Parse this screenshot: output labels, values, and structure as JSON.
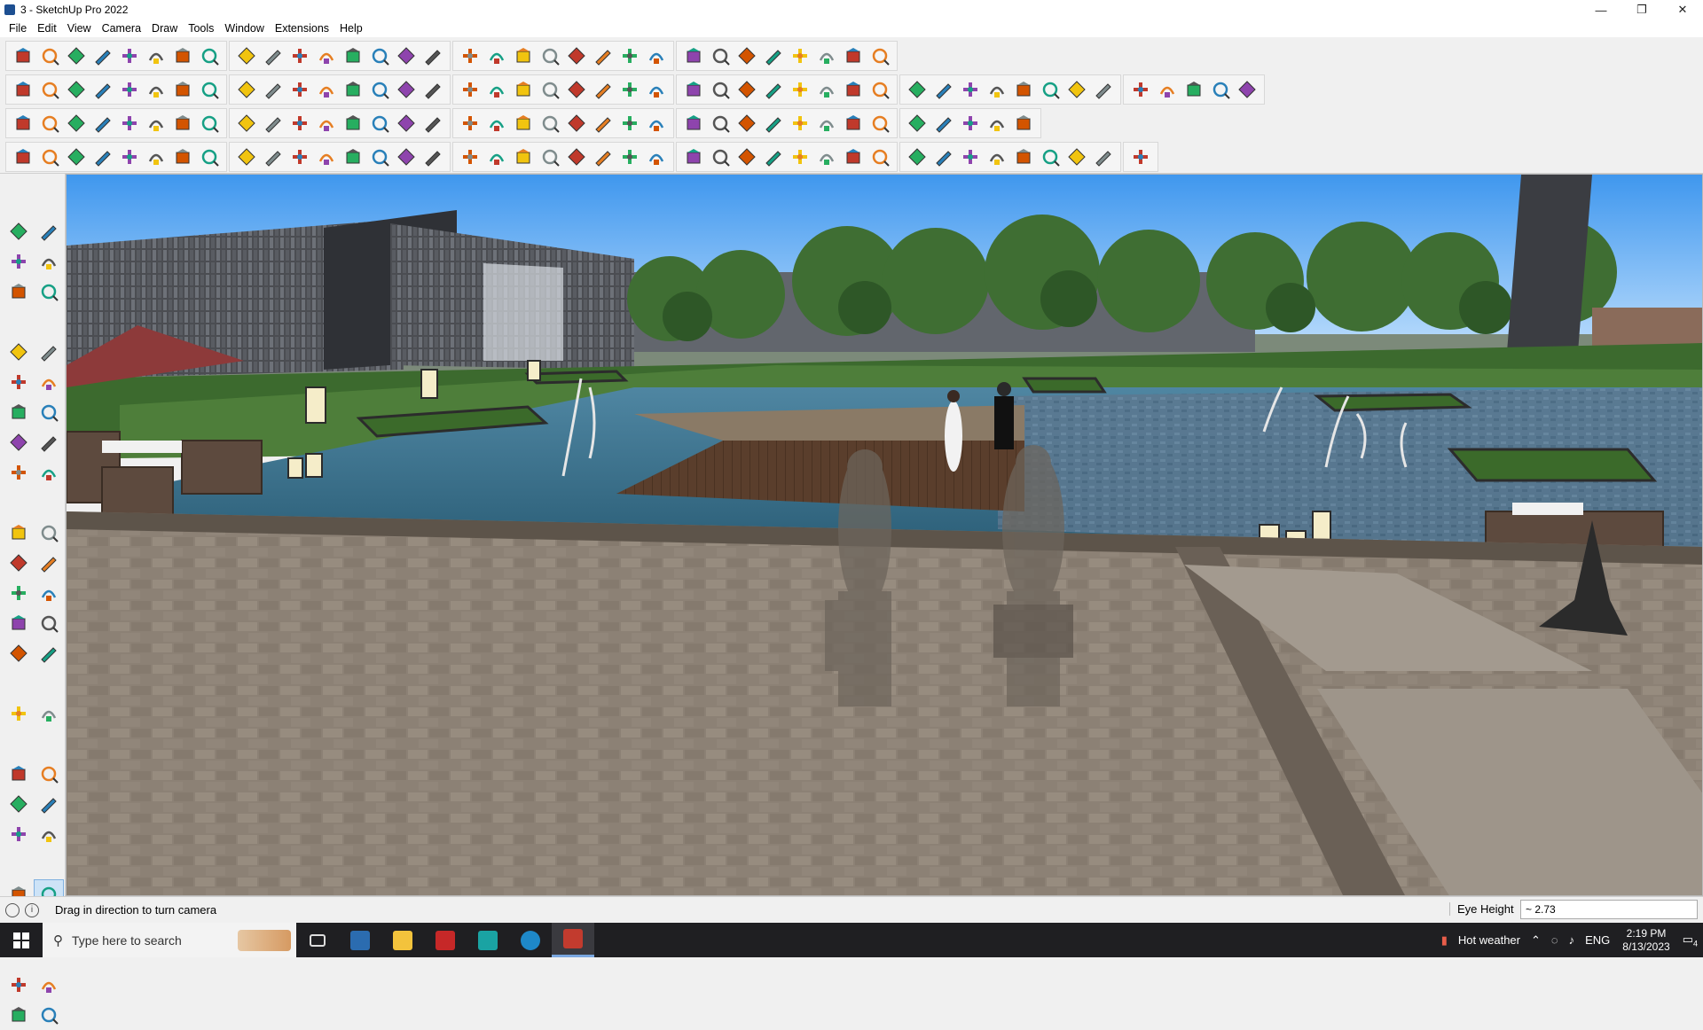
{
  "window": {
    "title": "3 - SketchUp Pro 2022",
    "minimize": "—",
    "maximize": "❐",
    "close": "✕"
  },
  "menu": [
    "File",
    "Edit",
    "View",
    "Camera",
    "Draw",
    "Tools",
    "Window",
    "Extensions",
    "Help"
  ],
  "status": {
    "hint": "Drag in direction to turn camera",
    "vcb_label": "Eye Height",
    "vcb_value": "~ 2.73"
  },
  "taskbar": {
    "search_placeholder": "Type here to search",
    "weather": "Hot weather",
    "language": "ENG",
    "time": "2:19 PM",
    "date": "8/13/2023",
    "notifications": "4"
  },
  "colors": {
    "accent": "#1d6fc4",
    "taskbar": "#1f1f22"
  },
  "icons": {
    "toolbar_row1": [
      "zoom-icon",
      "select-icon",
      "eraser-icon",
      "pencil-icon",
      "lasso-icon",
      "rectangle-icon",
      "push-pull-icon",
      "follow-me-icon",
      "move-icon",
      "rotate-icon",
      "scale-icon",
      "tape-measure-icon",
      "text-icon",
      "paint-bucket-icon",
      "orbit-icon",
      "pan-icon",
      "zoom-window-icon",
      "zoom-extents-icon",
      "components-icon",
      "styles-icon",
      "layers-icon",
      "scenes-icon",
      "user-icon",
      "model-info-icon",
      "sandbox-icon",
      "section-plane-icon",
      "arrows-icon",
      "export-icon",
      "axes-icon",
      "undo-icon",
      "redo-icon",
      "help-icon"
    ],
    "toolbar_row2": [
      "iso-view-icon",
      "top-view-icon",
      "front-view-icon",
      "extension-icon",
      "solid-union-icon",
      "solid-subtract-icon",
      "solid-intersect-icon",
      "solid-trim-icon",
      "solid-split-icon",
      "solid-outer-icon",
      "solid-shell-icon",
      "solid-fix-icon",
      "curve-icon",
      "line-tool-icon",
      "edge-tool-icon",
      "dimension-icon",
      "layer-flat-icon",
      "layer-up-icon",
      "roof-icon",
      "wall-icon",
      "house-icon",
      "house-outline-icon",
      "roof-open-icon",
      "fence-icon",
      "leaf-icon",
      "brush-icon",
      "circle-a-icon",
      "circle-b-icon",
      "polygon-a-icon",
      "polygon-b-icon",
      "ellipse-icon",
      "shape-a-icon",
      "shape-b-icon",
      "shape-c-icon",
      "shape-d-icon",
      "shape-e-icon",
      "arrow-red-icon",
      "eraser-pink-icon",
      "panel-a-icon",
      "panel-b-icon",
      "tile-a-icon",
      "tile-b-icon",
      "tile-c-icon",
      "tile-d-icon",
      "tile-e-icon"
    ],
    "toolbar_row3": [
      "cube-blue-icon",
      "diamond-blue-icon",
      "diamond-yellow-icon",
      "diamond-green-icon",
      "diamond-red-icon",
      "diamond-white-icon",
      "arc-orange-icon",
      "square-red-icon",
      "grid-box-icon",
      "panel-flip-icon",
      "block-icon",
      "chain-icon",
      "bracket-icon",
      "dots-line-icon",
      "cross-red-icon",
      "cross-green-icon",
      "cross-blue-icon",
      "cone-teal-icon",
      "pyramid-teal-icon",
      "triangle-warning-icon",
      "hook-icon",
      "nut-icon",
      "spiral-icon",
      "star-move-icon",
      "bucket-icon",
      "curl-red-icon",
      "frame-green-icon",
      "gear-icon",
      "cubes-icon",
      "box-red-icon",
      "ring-icon",
      "wood-a-icon",
      "wood-b-icon",
      "wood-c-icon",
      "network-icon",
      "bracket-b-icon",
      "mesh-icon"
    ],
    "toolbar_row4": [
      "path-a-icon",
      "path-b-icon",
      "drive-icon",
      "scissors-icon",
      "settings-icon",
      "shape-f-icon",
      "flow-icon",
      "box-3d-icon",
      "sphere-icon",
      "extend-icon",
      "corner-a-icon",
      "corner-b-icon",
      "knife-icon",
      "bend-icon",
      "extrude-icon",
      "wedge-icon",
      "fence-a-icon",
      "fence-b-icon",
      "hand-icon",
      "leaf-b-icon",
      "rail-a-icon",
      "rail-b-icon",
      "hatch-a-icon",
      "hatch-b-icon",
      "hatch-c-icon",
      "hatch-d-icon",
      "stair-a-icon",
      "stair-b-icon",
      "stair-c-icon",
      "stair-d-icon",
      "stair-e-icon",
      "stair-f-icon",
      "stair-g-icon",
      "stair-h-icon",
      "stair-i-icon",
      "stair-j-icon",
      "wheel-a-icon",
      "wheel-b-icon",
      "ramp-icon",
      "pattern-icon",
      "shell-icon"
    ],
    "palette": [
      "select-icon",
      "orbit-icon",
      "paint-bucket-icon",
      "eraser-icon",
      "make-component-icon",
      "tape-measure-icon",
      "pencil-icon",
      "freehand-icon",
      "rectangle-icon",
      "rotated-rectangle-icon",
      "circle-icon",
      "polygon-icon",
      "arc-icon",
      "two-point-arc-icon",
      "pie-icon",
      "three-point-arc-icon",
      "move-icon",
      "push-pull-icon",
      "rotate-icon",
      "follow-me-icon",
      "scale-icon",
      "offset-icon",
      "tape-measure-b-icon",
      "dimension-icon",
      "protractor-icon",
      "text-icon",
      "axes-icon",
      "3d-text-icon",
      "orbit-b-icon",
      "pan-icon",
      "zoom-icon",
      "zoom-window-icon",
      "zoom-extents-icon",
      "previous-view-icon",
      "position-camera-icon",
      "look-around-icon",
      "walk-icon",
      "section-plane-icon",
      "components-icon",
      "styles-icon",
      "layers-icon",
      "scenes-icon"
    ]
  }
}
